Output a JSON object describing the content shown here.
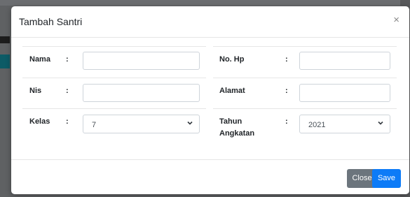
{
  "modal": {
    "title": "Tambah Santri",
    "close_symbol": "×"
  },
  "form": {
    "colon": ":",
    "nama_label": "Nama",
    "nis_label": "Nis",
    "kelas_label": "Kelas",
    "kelas_value": "7",
    "nohp_label": "No. Hp",
    "alamat_label": "Alamat",
    "tahun_label_line1": "Tahun",
    "tahun_label_line2": "Angkatan",
    "tahun_value": "2021"
  },
  "footer": {
    "close_label": "Close",
    "save_label": "Save"
  },
  "colors": {
    "primary": "#0d7bf7",
    "secondary": "#6c757d",
    "overlay": "#5f6163"
  },
  "icons": {
    "modal_close": "close-icon",
    "select_arrow": "chevron-down-icon"
  }
}
